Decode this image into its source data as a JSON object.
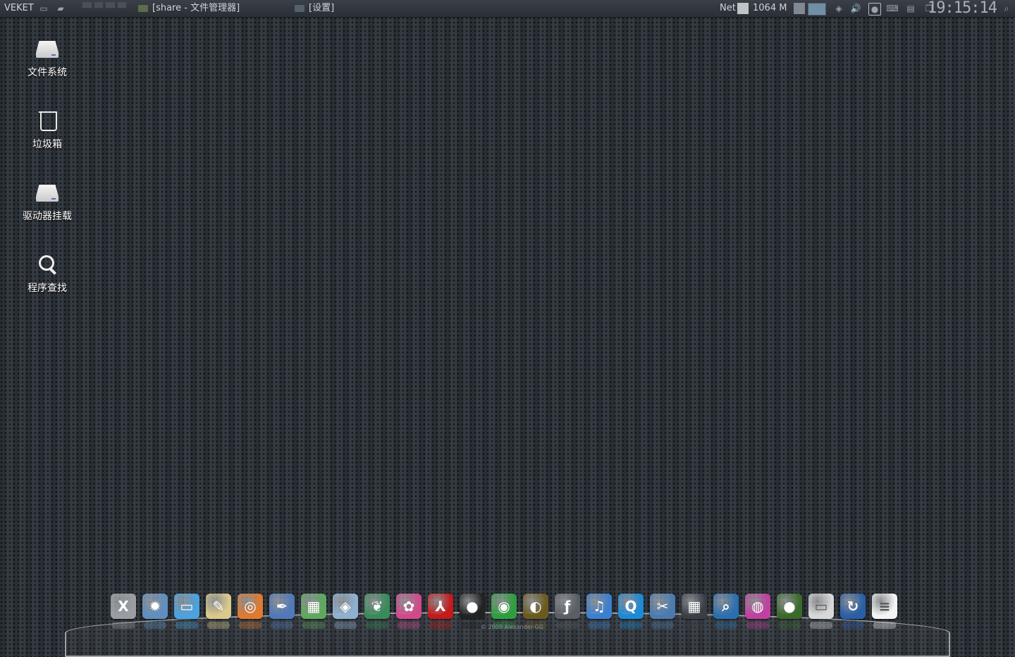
{
  "top_panel": {
    "brand": "VEKET",
    "tasks": [
      {
        "title": "[share - 文件管理器]"
      },
      {
        "title": "[设置]"
      }
    ],
    "net_label": "Net",
    "memory": "1064 M",
    "clock": "19:15:14"
  },
  "desktop": {
    "icons": [
      {
        "label": "文件系统",
        "icon": "drive-icon"
      },
      {
        "label": "垃圾箱",
        "icon": "trash-icon"
      },
      {
        "label": "驱动器挂载",
        "icon": "drive-icon"
      },
      {
        "label": "程序查找",
        "icon": "search-icon"
      }
    ]
  },
  "dock": {
    "copyright": "© 2009 Alexander-GG",
    "items": [
      {
        "name": "x-terminal-icon",
        "glyph": "X",
        "color": "#9a9ea3"
      },
      {
        "name": "settings-gear-icon",
        "glyph": "✹",
        "color": "#5f8fbf"
      },
      {
        "name": "monitor-icon",
        "glyph": "▭",
        "color": "#4aa3e0"
      },
      {
        "name": "text-editor-icon",
        "glyph": "✎",
        "color": "#d9c98a"
      },
      {
        "name": "network-icon",
        "glyph": "◎",
        "color": "#e07a30"
      },
      {
        "name": "draw-icon",
        "glyph": "✒",
        "color": "#4f79b8"
      },
      {
        "name": "spreadsheet-icon",
        "glyph": "▦",
        "color": "#5fa85f"
      },
      {
        "name": "office-icon",
        "glyph": "◈",
        "color": "#8fb0d0"
      },
      {
        "name": "feather-icon",
        "glyph": "❦",
        "color": "#3a8a5a"
      },
      {
        "name": "flower-icon",
        "glyph": "✿",
        "color": "#d04a8a"
      },
      {
        "name": "pdf-reader-icon",
        "glyph": "⅄",
        "color": "#c41a1a"
      },
      {
        "name": "qq-penguin-icon",
        "glyph": "●",
        "color": "#222222"
      },
      {
        "name": "chrome-icon",
        "glyph": "◉",
        "color": "#2f9e3f"
      },
      {
        "name": "media-player-icon",
        "glyph": "◐",
        "color": "#6b5a1f"
      },
      {
        "name": "flash-icon",
        "glyph": "ƒ",
        "color": "#5a5f66"
      },
      {
        "name": "music-icon",
        "glyph": "♫",
        "color": "#3a7fd0"
      },
      {
        "name": "quicktime-icon",
        "glyph": "Q",
        "color": "#1c8ad6"
      },
      {
        "name": "screenshot-icon",
        "glyph": "✂",
        "color": "#4a7bb0"
      },
      {
        "name": "apps-grid-icon",
        "glyph": "▦",
        "color": "#3a3f46"
      },
      {
        "name": "search-magnifier-icon",
        "glyph": "⌕",
        "color": "#2a6fb0"
      },
      {
        "name": "color-picker-icon",
        "glyph": "◍",
        "color": "#c040a0"
      },
      {
        "name": "sphere-icon",
        "glyph": "●",
        "color": "#3a6a2a"
      },
      {
        "name": "blank-drive-icon",
        "glyph": "▭",
        "color": "#d8d8d8"
      },
      {
        "name": "refresh-icon",
        "glyph": "↻",
        "color": "#2a5fa8"
      },
      {
        "name": "document-thumbnail-icon",
        "glyph": "≡",
        "color": "#f4f4f4"
      }
    ]
  }
}
